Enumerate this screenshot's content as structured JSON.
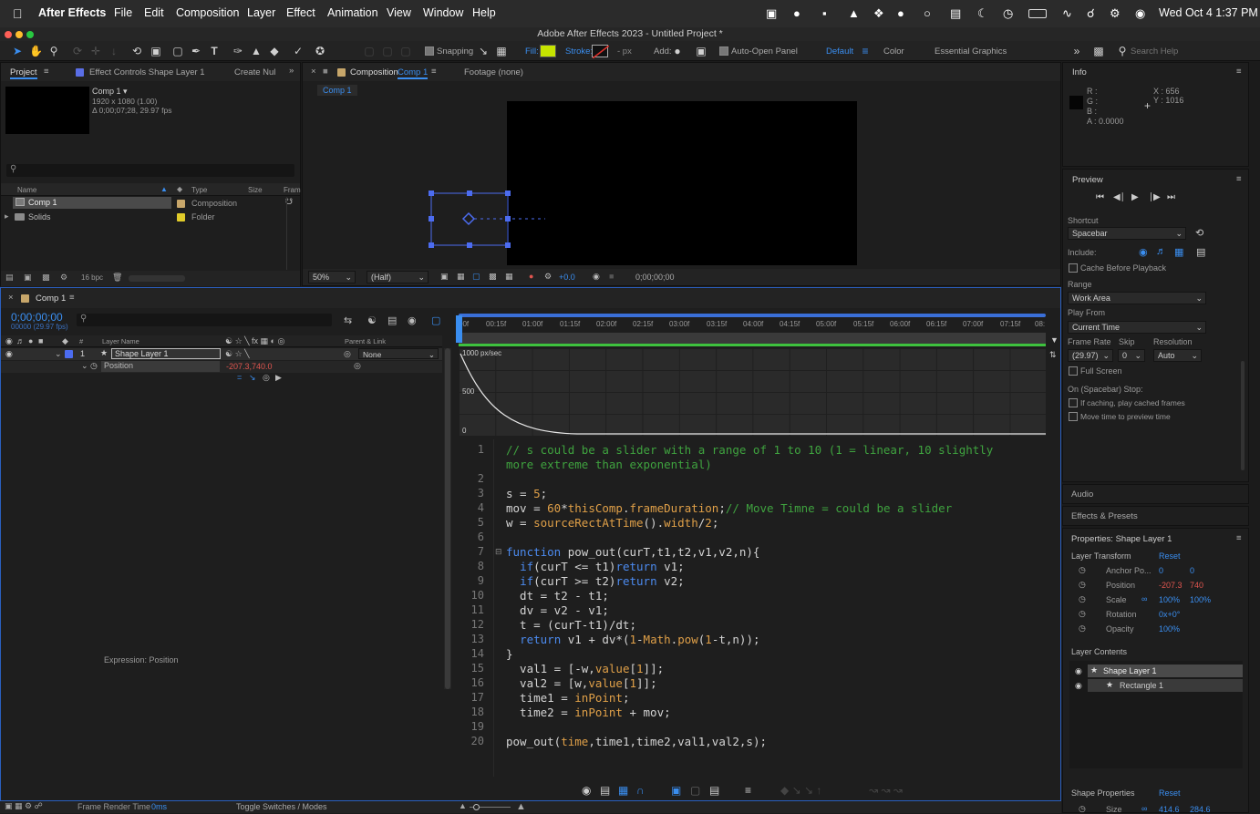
{
  "menu": {
    "app": "After Effects",
    "items": [
      "File",
      "Edit",
      "Composition",
      "Layer",
      "Effect",
      "Animation",
      "View",
      "Window",
      "Help"
    ],
    "clock": "Wed Oct 4  1:37 PM"
  },
  "window_title": "Adobe After Effects 2023 - Untitled Project *",
  "toolbar": {
    "snapping": "Snapping",
    "fill": "Fill:",
    "stroke": "Stroke:",
    "stroke_px": "- px",
    "add": "Add:",
    "auto_open": "Auto-Open Panel",
    "workspace_default": "Default",
    "workspace_color": "Color",
    "workspace_eg": "Essential Graphics",
    "search_placeholder": "Search Help"
  },
  "project": {
    "tabs": [
      "Project",
      "Effect Controls Shape Layer 1",
      "Create Nul"
    ],
    "comp_name": "Comp 1 ▾",
    "comp_res": "1920 x 1080 (1.00)",
    "comp_dur": "Δ 0;00;07;28, 29.97 fps",
    "col_name": "Name",
    "col_type": "Type",
    "col_size": "Size",
    "col_frame": "Fram",
    "items": [
      {
        "name": "Comp 1",
        "type": "Composition"
      },
      {
        "name": "Solids",
        "type": "Folder"
      }
    ],
    "bpc": "16 bpc"
  },
  "viewer": {
    "tab": "Composition",
    "tab_comp": "Comp 1",
    "footage": "Footage (none)",
    "crumb": "Comp 1",
    "zoom": "50%",
    "quality": "(Half)",
    "exposure": "+0.0",
    "timecode": "0;00;00;00"
  },
  "timeline": {
    "tab": "Comp 1",
    "timecode": "0;00;00;00",
    "fps": "00000 (29.97 fps)",
    "col_layer": "Layer Name",
    "col_parent": "Parent & Link",
    "layer_num": "1",
    "layer_name": "Shape Layer 1",
    "parent": "None",
    "prop": "Position",
    "prop_val": "-207.3,740.0",
    "expr_label": "Expression: Position",
    "ruler": [
      "00f",
      "00:15f",
      "01:00f",
      "01:15f",
      "02:00f",
      "02:15f",
      "03:00f",
      "03:15f",
      "04:00f",
      "04:15f",
      "05:00f",
      "05:15f",
      "06:00f",
      "06:15f",
      "07:00f",
      "07:15f",
      "08:"
    ],
    "graph_top": "1000 px/sec",
    "graph_mid": "500",
    "graph_zero": "0",
    "footer_render": "Frame Render Time",
    "footer_ms": "0ms",
    "footer_toggle": "Toggle Switches / Modes"
  },
  "code_lines": [
    {
      "n": "1",
      "t": "// s could be a slider with a range of 1 to 10 (1 = linear, 10 slightly"
    },
    {
      "n": "",
      "t": "more extreme than exponential)"
    },
    {
      "n": "2",
      "t": ""
    },
    {
      "n": "3",
      "t": "s = 5;"
    },
    {
      "n": "4",
      "t": "mov = 60*thisComp.frameDuration;// Move Timne = could be a slider"
    },
    {
      "n": "5",
      "t": "w = sourceRectAtTime().width/2;"
    },
    {
      "n": "6",
      "t": ""
    },
    {
      "n": "7",
      "t": "function pow_out(curT,t1,t2,v1,v2,n){"
    },
    {
      "n": "8",
      "t": "  if(curT <= t1)return v1;"
    },
    {
      "n": "9",
      "t": "  if(curT >= t2)return v2;"
    },
    {
      "n": "10",
      "t": "  dt = t2 - t1;"
    },
    {
      "n": "11",
      "t": "  dv = v2 - v1;"
    },
    {
      "n": "12",
      "t": "  t = (curT-t1)/dt;"
    },
    {
      "n": "13",
      "t": "  return v1 + dv*(1-Math.pow(1-t,n));"
    },
    {
      "n": "14",
      "t": "}"
    },
    {
      "n": "15",
      "t": "  val1 = [-w,value[1]];"
    },
    {
      "n": "16",
      "t": "  val2 = [w,value[1]];"
    },
    {
      "n": "17",
      "t": "  time1 = inPoint;"
    },
    {
      "n": "18",
      "t": "  time2 = inPoint + mov;"
    },
    {
      "n": "19",
      "t": ""
    },
    {
      "n": "20",
      "t": "pow_out(time,time1,time2,val1,val2,s);"
    }
  ],
  "info": {
    "title": "Info",
    "r": "R :",
    "g": "G :",
    "b": "B :",
    "a": "A : 0.0000",
    "x": "X : 656",
    "y": "Y : 1016"
  },
  "preview": {
    "title": "Preview",
    "shortcut_label": "Shortcut",
    "shortcut": "Spacebar",
    "include": "Include:",
    "cache": "Cache Before Playback",
    "range_label": "Range",
    "range": "Work Area",
    "playfrom_label": "Play From",
    "playfrom": "Current Time",
    "fr_label": "Frame Rate",
    "skip_label": "Skip",
    "res_label": "Resolution",
    "fr": "(29.97)",
    "skip": "0",
    "res": "Auto",
    "fullscreen": "Full Screen",
    "stop_label": "On (Spacebar) Stop:",
    "stop1": "If caching, play cached frames",
    "stop2": "Move time to preview time"
  },
  "audio": "Audio",
  "effects": "Effects & Presets",
  "props": {
    "title": "Properties: Shape Layer 1",
    "transform": "Layer Transform",
    "reset": "Reset",
    "rows": [
      {
        "label": "Anchor Po...",
        "v1": "0",
        "v2": "0"
      },
      {
        "label": "Position",
        "v1": "-207.3",
        "v2": "740"
      },
      {
        "label": "Scale",
        "v1": "100%",
        "v2": "100%"
      },
      {
        "label": "Rotation",
        "v1": "0x+0°",
        "v2": ""
      },
      {
        "label": "Opacity",
        "v1": "100%",
        "v2": ""
      }
    ],
    "contents": "Layer Contents",
    "layer1": "Shape Layer 1",
    "layer2": "Rectangle 1",
    "shape_props": "Shape Properties",
    "shape_reset": "Reset",
    "size_label": "Size",
    "size1": "414.6",
    "size2": "284.6"
  }
}
